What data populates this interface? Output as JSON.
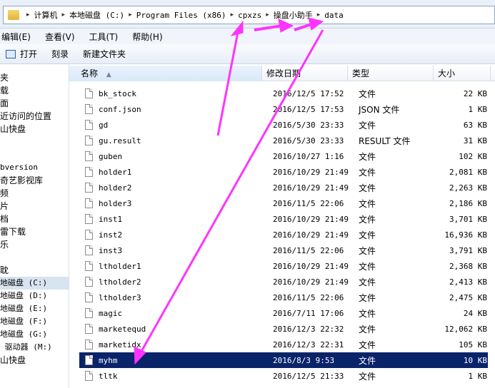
{
  "address": {
    "crumbs": [
      "计算机",
      "本地磁盘 (C:)",
      "Program Files (x86)",
      "cpxzs",
      "操盘小助手",
      "data"
    ]
  },
  "menu": {
    "items": [
      "编辑(E)",
      "查看(V)",
      "工具(T)",
      "帮助(H)"
    ]
  },
  "toolbar": {
    "open_label": "打开",
    "burn_label": "刻录",
    "newfolder_label": "新建文件夹"
  },
  "nav": {
    "items": [
      "夹",
      "载",
      "面",
      "近访问的位置",
      "山快盘",
      "bversion",
      "奇艺影视库",
      "频",
      "片",
      "档",
      "雷下载",
      "乐",
      "耽",
      "地磁盘 (C:)",
      "地磁盘 (D:)",
      "地磁盘 (E:)",
      "地磁盘 (F:)",
      "地磁盘 (G:)",
      " 驱动器 (M:)",
      "山快盘"
    ]
  },
  "columns": {
    "name": "名称",
    "date": "修改日期",
    "type": "类型",
    "size": "大小"
  },
  "files": [
    {
      "name": "bk_stock",
      "date": "2016/12/5 17:52",
      "type": "文件",
      "size": "22 KB"
    },
    {
      "name": "conf.json",
      "date": "2016/12/5 17:53",
      "type": "JSON 文件",
      "size": "1 KB"
    },
    {
      "name": "gd",
      "date": "2016/5/30 23:33",
      "type": "文件",
      "size": "63 KB"
    },
    {
      "name": "gu.result",
      "date": "2016/5/30 23:33",
      "type": "RESULT 文件",
      "size": "31 KB"
    },
    {
      "name": "guben",
      "date": "2016/10/27 1:16",
      "type": "文件",
      "size": "102 KB"
    },
    {
      "name": "holder1",
      "date": "2016/10/29 21:49",
      "type": "文件",
      "size": "2,081 KB"
    },
    {
      "name": "holder2",
      "date": "2016/10/29 21:49",
      "type": "文件",
      "size": "2,263 KB"
    },
    {
      "name": "holder3",
      "date": "2016/11/5 22:06",
      "type": "文件",
      "size": "2,186 KB"
    },
    {
      "name": "inst1",
      "date": "2016/10/29 21:49",
      "type": "文件",
      "size": "3,701 KB"
    },
    {
      "name": "inst2",
      "date": "2016/10/29 21:49",
      "type": "文件",
      "size": "16,936 KB"
    },
    {
      "name": "inst3",
      "date": "2016/11/5 22:06",
      "type": "文件",
      "size": "3,791 KB"
    },
    {
      "name": "ltholder1",
      "date": "2016/10/29 21:49",
      "type": "文件",
      "size": "2,368 KB"
    },
    {
      "name": "ltholder2",
      "date": "2016/10/29 21:49",
      "type": "文件",
      "size": "2,413 KB"
    },
    {
      "name": "ltholder3",
      "date": "2016/11/5 22:06",
      "type": "文件",
      "size": "2,475 KB"
    },
    {
      "name": "magic",
      "date": "2016/7/11 17:06",
      "type": "文件",
      "size": "24 KB"
    },
    {
      "name": "marketequd",
      "date": "2016/12/3 22:32",
      "type": "文件",
      "size": "12,062 KB"
    },
    {
      "name": "marketidx",
      "date": "2016/12/3 22:31",
      "type": "文件",
      "size": "105 KB"
    },
    {
      "name": "myhm",
      "date": "2016/8/3 9:53",
      "type": "文件",
      "size": "10 KB"
    },
    {
      "name": "tltk",
      "date": "2016/12/5 21:33",
      "type": "文件",
      "size": "1 KB"
    }
  ],
  "colors": {
    "arrow": "#ff33ff",
    "selection": "#0a246a"
  }
}
